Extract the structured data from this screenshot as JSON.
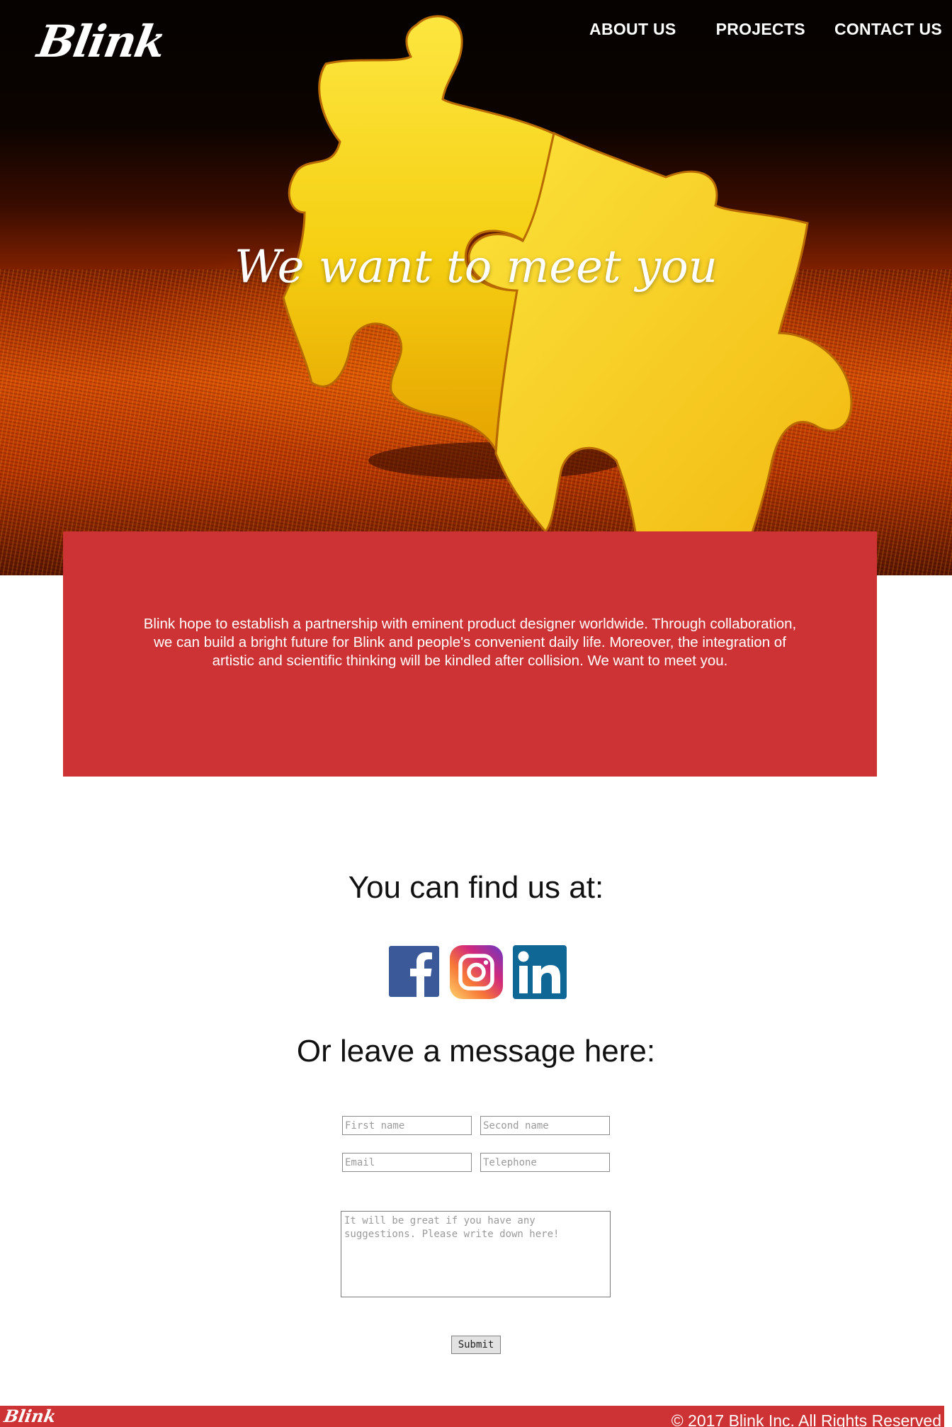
{
  "header": {
    "logo": "Blink",
    "nav": [
      {
        "label": "ABOUT US"
      },
      {
        "label": "PROJECTS"
      },
      {
        "label": "CONTACT US"
      }
    ]
  },
  "hero": {
    "title": "We want to meet you"
  },
  "intro": {
    "text": "Blink hope to establish a partnership with eminent product designer worldwide. Through collaboration, we can build a bright future for Blink and people's convenient daily life. Moreover, the integration of artistic and scientific thinking will be kindled after collision. We want to meet you."
  },
  "contact": {
    "find_title": "You can find us at:",
    "socials": [
      {
        "icon": "facebook-icon",
        "color": "#3b5998"
      },
      {
        "icon": "instagram-icon",
        "color": "#c13584"
      },
      {
        "icon": "linkedin-icon",
        "color": "#0e6795"
      }
    ],
    "message_title": "Or leave a message here:"
  },
  "form": {
    "first_name_placeholder": "First name",
    "second_name_placeholder": "Second name",
    "email_placeholder": "Email",
    "telephone_placeholder": "Telephone",
    "message_placeholder": "It will be great if you have any suggestions. Please write down here!",
    "submit_label": "Submit"
  },
  "footer": {
    "logo": "Blink",
    "copyright": "© 2017 Blink Inc. All Rights Reserved"
  },
  "colors": {
    "brand_red": "#cd3334",
    "puzzle_yellow": "#f6d51f"
  }
}
